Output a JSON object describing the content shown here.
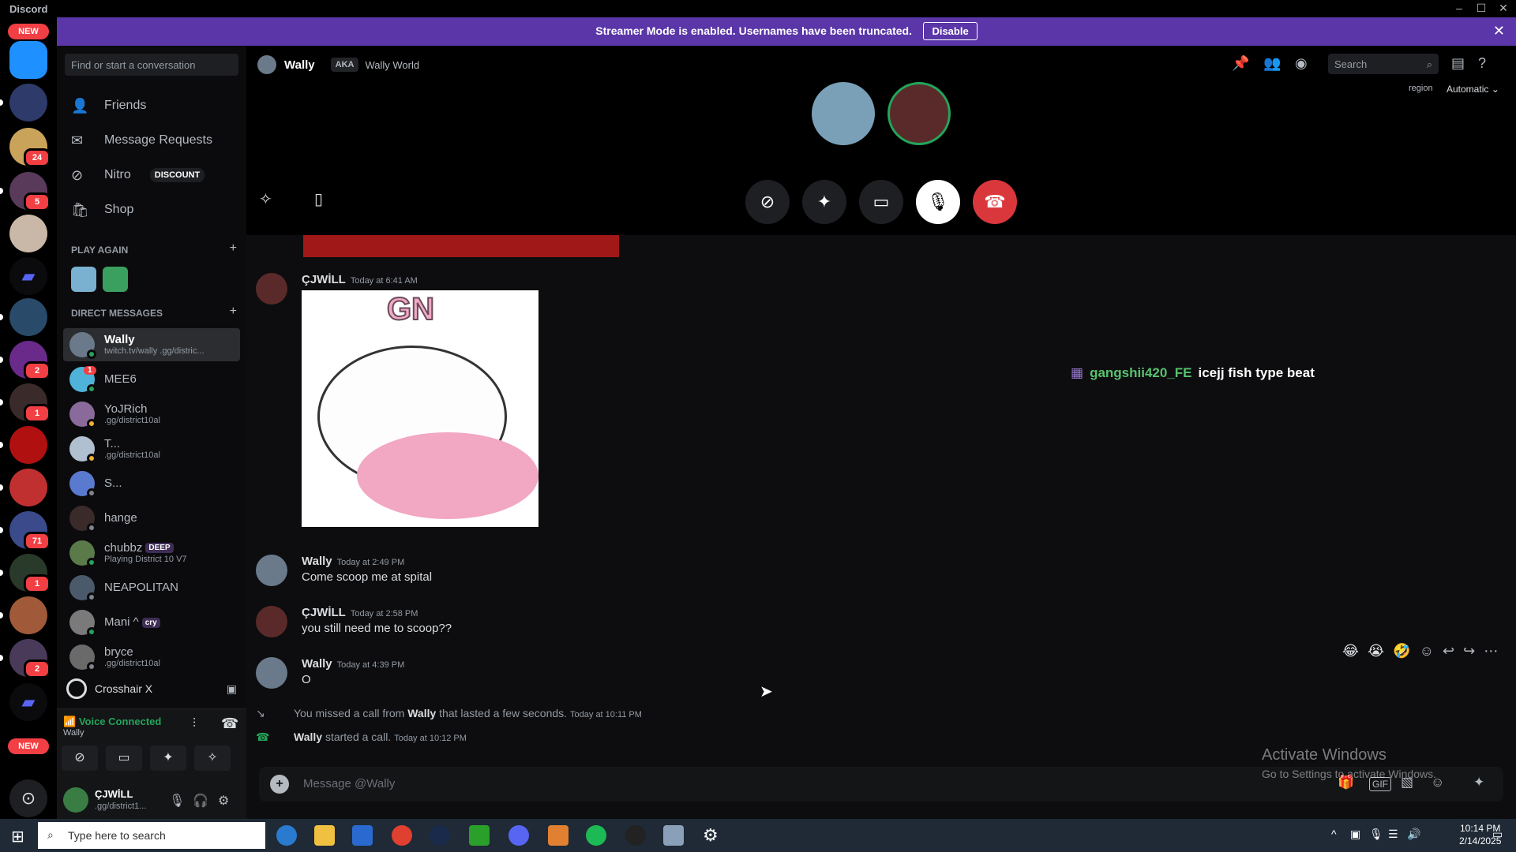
{
  "window": {
    "title": "Discord",
    "minimize": "–",
    "maximize": "☐",
    "close": "✕"
  },
  "banner": {
    "text": "Streamer Mode is enabled. Usernames have been truncated.",
    "button": "Disable",
    "close": "✕"
  },
  "servers": {
    "new_top": "NEW",
    "new_bottom": "NEW",
    "badges": [
      "24",
      "5",
      "2",
      "1",
      "71",
      "1",
      "2"
    ]
  },
  "dm_sidebar": {
    "search_placeholder": "Find or start a conversation",
    "nav": [
      {
        "label": "Friends",
        "icon": "friends-icon"
      },
      {
        "label": "Message Requests",
        "icon": "mail-icon"
      },
      {
        "label": "Nitro",
        "icon": "nitro-icon",
        "badge": "DISCOUNT"
      },
      {
        "label": "Shop",
        "icon": "shop-icon"
      }
    ],
    "play_again": "PLAY AGAIN",
    "direct_messages": "DIRECT MESSAGES",
    "dms": [
      {
        "name": "Wally",
        "sub": "twitch.tv/wally .gg/distric...",
        "active": true,
        "color": "#6a7a8a",
        "status": "#23a55a"
      },
      {
        "name": "MEE6",
        "sub": "",
        "color": "#4fb3d9",
        "status": "#23a55a",
        "badge": "1"
      },
      {
        "name": "YoJRich",
        "sub": ".gg/district10al",
        "color": "#8a6a9a",
        "status": "#f0b232"
      },
      {
        "name": "T...",
        "sub": ".gg/district10al",
        "color": "#b0c0d0",
        "status": "#f0b232"
      },
      {
        "name": "S...",
        "sub": "",
        "color": "#5a7ad0",
        "status": "#80848e"
      },
      {
        "name": "hange",
        "sub": "",
        "color": "#3a2a2a",
        "status": "#80848e"
      },
      {
        "name": "chubbz",
        "sub": "Playing District 10 V7",
        "color": "#5a7a4a",
        "status": "#23a55a",
        "tag": "DEEP"
      },
      {
        "name": "NEAPOLITAN",
        "sub": "",
        "color": "#4a5a6a",
        "status": "#80848e"
      },
      {
        "name": "Mani ^",
        "sub": "",
        "color": "#7a7a7a",
        "status": "#23a55a",
        "tag": "cry"
      },
      {
        "name": "bryce",
        "sub": ".gg/district10al",
        "color": "#6a6a6a",
        "status": "#80848e"
      }
    ],
    "activity": "Crosshair X",
    "voice_connected": "Voice Connected",
    "voice_channel": "Wally",
    "user_name": "ÇJWİLL",
    "user_sub": ".gg/district1..."
  },
  "header": {
    "name": "Wally",
    "aka": "AKA",
    "aka_name": "Wally World",
    "search_placeholder": "Search",
    "region_label": "region",
    "region_value": "Automatic ⌄"
  },
  "messages": [
    {
      "author": "ÇJWİLL",
      "time": "Today at 6:41 AM",
      "text": "",
      "image_text": "GN"
    },
    {
      "author": "Wally",
      "time": "Today at 2:49 PM",
      "text": "Come scoop me at spital"
    },
    {
      "author": "ÇJWİLL",
      "time": "Today at 2:58 PM",
      "text": "you still need me to scoop??"
    },
    {
      "author": "Wally",
      "time": "Today at 4:39 PM",
      "text": "O"
    }
  ],
  "system": [
    {
      "pre": "You missed a call from",
      "user": "Wally",
      "post": "that lasted a few seconds.",
      "time": "Today at 10:11 PM"
    },
    {
      "pre": "",
      "user": "Wally",
      "post": "started a call.",
      "time": "Today at 10:12 PM"
    }
  ],
  "overlay": {
    "user": "gangshii420_FE",
    "text": "icejj fish type beat"
  },
  "reactions": [
    "😂",
    "😭",
    "🤣"
  ],
  "composer": {
    "placeholder": "Message @Wally"
  },
  "watermark": {
    "line1": "Activate Windows",
    "line2": "Go to Settings to activate Windows."
  },
  "taskbar": {
    "search_placeholder": "Type here to search",
    "time": "10:14 PM",
    "date": "2/14/2025"
  }
}
